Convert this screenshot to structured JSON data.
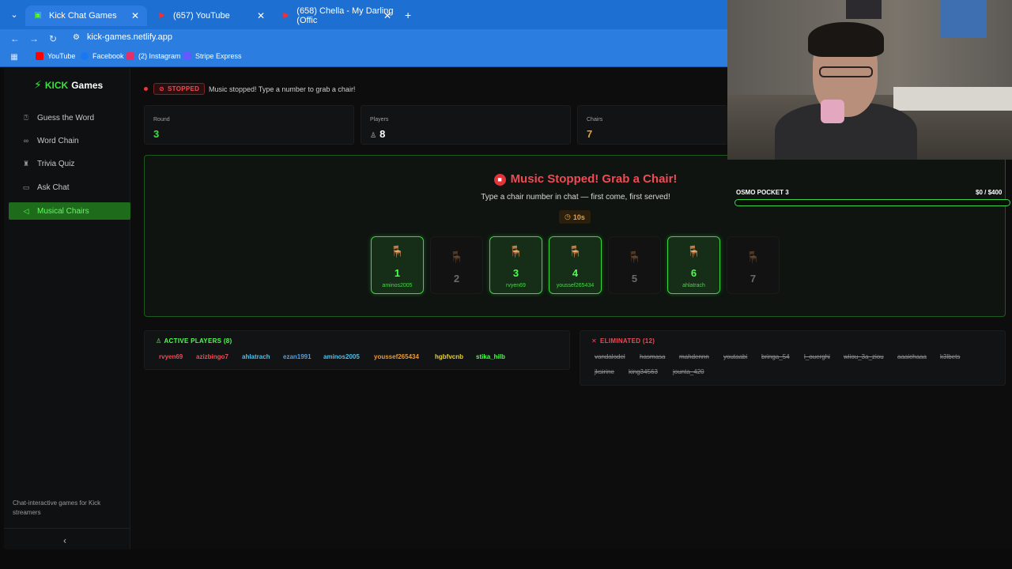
{
  "browser": {
    "tabs": [
      {
        "title": "Kick Chat Games",
        "favicon_color": "#53fc18"
      },
      {
        "title": "(657) YouTube",
        "favicon_color": "#ff0000"
      },
      {
        "title": "(658) Chella - My Darling (Offic",
        "favicon_color": "#ff0000"
      }
    ],
    "url": "kick-games.netlify.app",
    "bookmarks": [
      {
        "label": "YouTube",
        "color": "#ff0000"
      },
      {
        "label": "Facebook",
        "color": "#1877f2"
      },
      {
        "label": "(2) Instagram",
        "color": "#e1306c"
      },
      {
        "label": "Stripe Express",
        "color": "#635bff"
      }
    ]
  },
  "brand": {
    "kick": "KICK",
    "games": "Games"
  },
  "sidebar": {
    "items": [
      {
        "label": "Guess the Word",
        "icon": "help-circle-icon"
      },
      {
        "label": "Word Chain",
        "icon": "link-icon"
      },
      {
        "label": "Trivia Quiz",
        "icon": "trophy-icon"
      },
      {
        "label": "Ask Chat",
        "icon": "chat-icon"
      },
      {
        "label": "Musical Chairs",
        "icon": "speaker-icon",
        "active": true
      }
    ],
    "footer": "Chat-interactive games for Kick streamers"
  },
  "status": {
    "badge": "STOPPED",
    "message": "Music stopped! Type a number to grab a chair!"
  },
  "stats": {
    "round": {
      "label": "Round",
      "value": "3"
    },
    "players": {
      "label": "Players",
      "value": "8"
    },
    "chairs": {
      "label": "Chairs",
      "value": "7"
    }
  },
  "game": {
    "title": "Music Stopped! Grab a Chair!",
    "subtitle": "Type a chair number in chat — first come, first served!",
    "timer": "10s",
    "chairs": [
      {
        "num": "1",
        "player": "aminos2005",
        "taken": true
      },
      {
        "num": "2",
        "player": "",
        "taken": false
      },
      {
        "num": "3",
        "player": "rvyen69",
        "taken": true
      },
      {
        "num": "4",
        "player": "youssef265434",
        "taken": true
      },
      {
        "num": "5",
        "player": "",
        "taken": false
      },
      {
        "num": "6",
        "player": "ahlatrach",
        "taken": true
      },
      {
        "num": "7",
        "player": "",
        "taken": false
      }
    ]
  },
  "active_players": {
    "title": "ACTIVE PLAYERS (8)",
    "players": [
      {
        "name": "rvyen69",
        "color": "#ef4a55"
      },
      {
        "name": "azizbingo7",
        "color": "#ef4a55"
      },
      {
        "name": "ahlatrach",
        "color": "#4fc0e8"
      },
      {
        "name": "ezan1991",
        "color": "#4fa0e8"
      },
      {
        "name": "aminos2005",
        "color": "#4fc0e8"
      },
      {
        "name": "youssef265434",
        "color": "#e89a3a"
      },
      {
        "name": "hgbfvcnb",
        "color": "#e8d23a"
      },
      {
        "name": "stika_hilb",
        "color": "#4dff4d"
      }
    ]
  },
  "eliminated": {
    "title": "ELIMINATED (12)",
    "players": [
      "vandalodel",
      "hasmasa",
      "mahdennn",
      "youtaabi",
      "bringa_54",
      "l_ouerghi",
      "wiiou_3a_ziou",
      "aaaichaaa",
      "k3lbets",
      "jksirine",
      "king34563",
      "jounta_420"
    ]
  },
  "overlay": {
    "goal_label": "OSMO POCKET 3",
    "goal_amount": "$0  / $400",
    "goal_progress": 0.0
  },
  "colors": {
    "accent": "#39e33b",
    "danger": "#ef4a55",
    "warning": "#e6a03a"
  }
}
